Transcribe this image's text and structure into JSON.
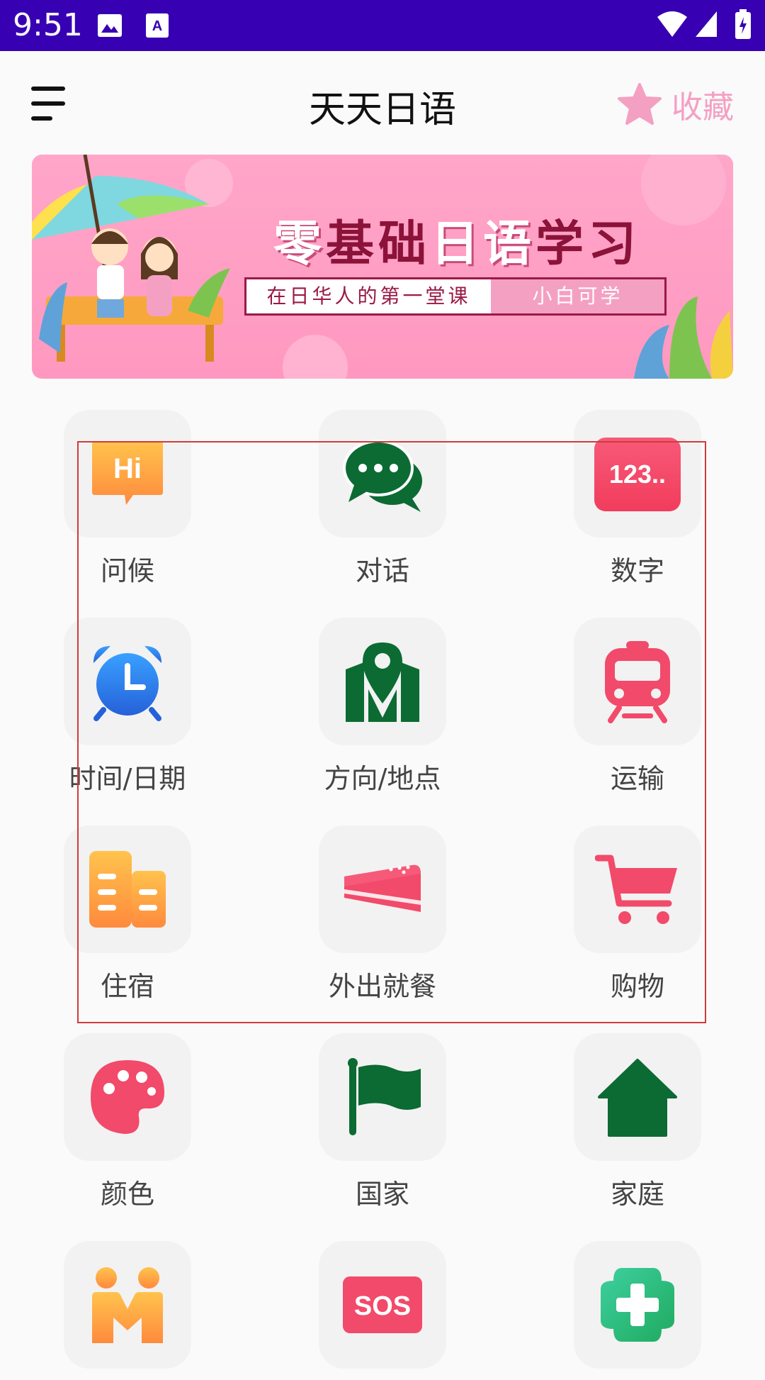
{
  "status": {
    "time": "9:51"
  },
  "header": {
    "title": "天天日语",
    "favorite_label": "收藏"
  },
  "banner": {
    "title_light_1": "零",
    "title_dark_1": "基础",
    "title_light_2": "日语",
    "title_dark_2": "学习",
    "subtitle_left": "在日华人的第一堂课",
    "subtitle_right": "小白可学"
  },
  "categories": [
    {
      "label": "问候",
      "icon": "hi-bubble-icon"
    },
    {
      "label": "对话",
      "icon": "chat-bubbles-icon"
    },
    {
      "label": "数字",
      "icon": "numbers-icon",
      "icon_text": "123.."
    },
    {
      "label": "时间/日期",
      "icon": "alarm-clock-icon"
    },
    {
      "label": "方向/地点",
      "icon": "map-pin-icon"
    },
    {
      "label": "运输",
      "icon": "train-icon"
    },
    {
      "label": "住宿",
      "icon": "buildings-icon"
    },
    {
      "label": "外出就餐",
      "icon": "cake-icon"
    },
    {
      "label": "购物",
      "icon": "cart-icon"
    },
    {
      "label": "颜色",
      "icon": "palette-icon"
    },
    {
      "label": "国家",
      "icon": "flag-icon"
    },
    {
      "label": "家庭",
      "icon": "home-icon"
    },
    {
      "label": "",
      "icon": "people-icon"
    },
    {
      "label": "",
      "icon": "sos-icon",
      "icon_text": "SOS"
    },
    {
      "label": "",
      "icon": "medical-cross-icon"
    }
  ],
  "colors": {
    "status_bar": "#3700b3",
    "accent_pink": "#f4a0c2",
    "green": "#0b6b33",
    "red": "#f24a6a",
    "orange": "#ffa43a",
    "blue": "#2f7ae5"
  }
}
